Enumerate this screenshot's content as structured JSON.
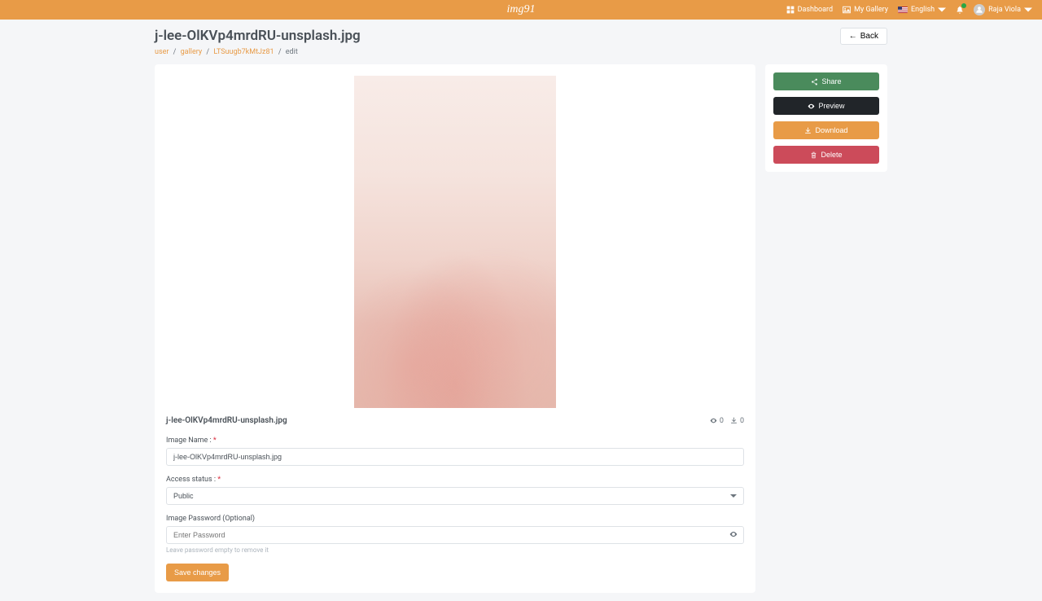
{
  "brand": "img91",
  "nav": {
    "dashboard": "Dashboard",
    "gallery": "My Gallery",
    "language": "English",
    "user": "Raja Viola"
  },
  "page": {
    "title": "j-lee-OlKVp4mrdRU-unsplash.jpg",
    "back": "Back"
  },
  "breadcrumb": {
    "user": "user",
    "gallery": "gallery",
    "id": "LTSuugb7kMtJz81",
    "current": "edit"
  },
  "image": {
    "name": "j-lee-OlKVp4mrdRU-unsplash.jpg",
    "views": "0",
    "downloads": "0"
  },
  "form": {
    "imageName": {
      "label": "Image Name :",
      "value": "j-lee-OlKVp4mrdRU-unsplash.jpg"
    },
    "accessStatus": {
      "label": "Access status :",
      "value": "Public"
    },
    "password": {
      "label": "Image Password (Optional)",
      "placeholder": "Enter Password",
      "hint": "Leave password empty to remove it"
    },
    "save": "Save changes"
  },
  "actions": {
    "share": "Share",
    "preview": "Preview",
    "download": "Download",
    "delete": "Delete"
  }
}
